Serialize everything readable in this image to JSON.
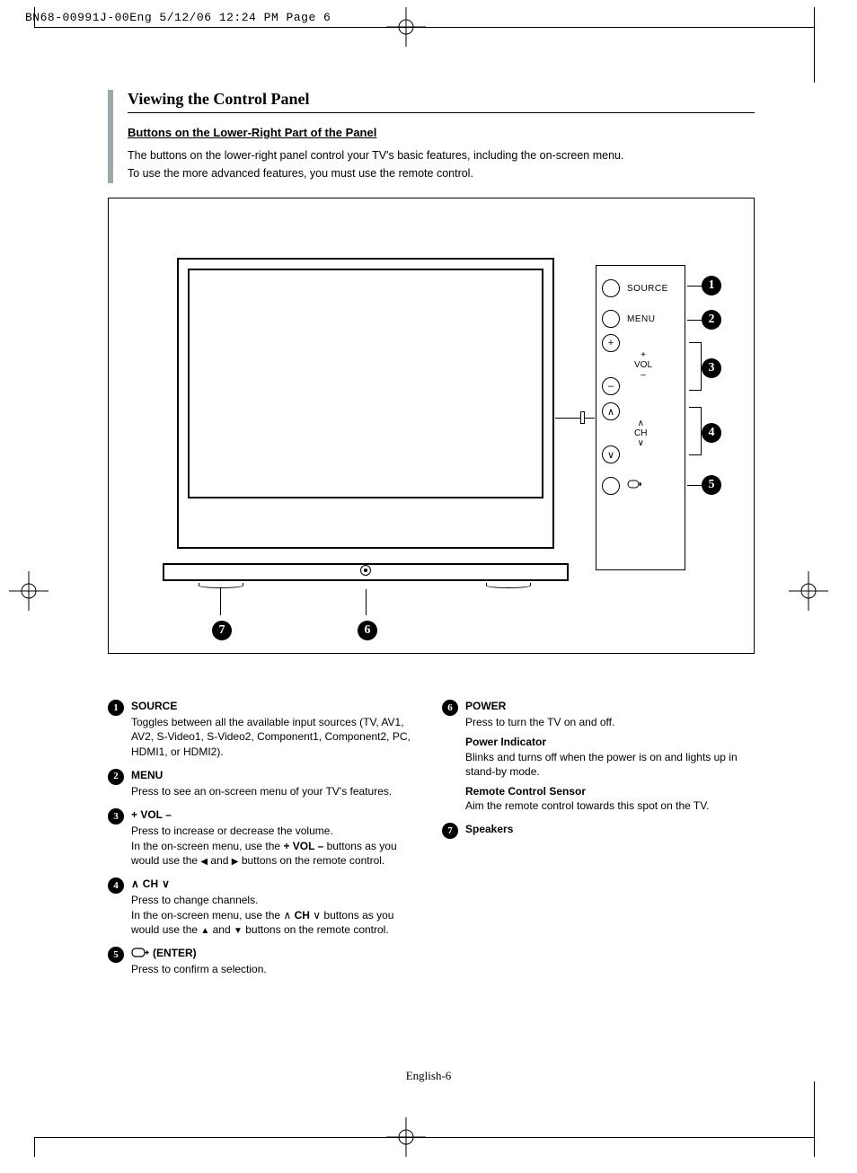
{
  "header": "BN68-00991J-00Eng  5/12/06  12:24 PM  Page 6",
  "title": "Viewing the Control Panel",
  "subtitle": "Buttons on the Lower-Right Part of the Panel",
  "intro1": "The buttons on the lower-right panel control your TV's basic features, including the on-screen menu.",
  "intro2": "To use the more advanced features, you must use the remote control.",
  "panel": {
    "source": "SOURCE",
    "menu": "MENU",
    "vol": "VOL",
    "ch": "CH"
  },
  "callouts": {
    "n1": "1",
    "n2": "2",
    "n3": "3",
    "n4": "4",
    "n5": "5",
    "n6": "6",
    "n7": "7"
  },
  "items": {
    "i1": {
      "title": "SOURCE",
      "body": "Toggles between all the available input sources (TV, AV1, AV2, S-Video1, S-Video2, Component1, Component2, PC, HDMI1, or HDMI2)."
    },
    "i2": {
      "title": "MENU",
      "body": "Press to see an on-screen menu of your TV's features."
    },
    "i3": {
      "title": "+ VOL –",
      "b1": "Press to increase or decrease the volume.",
      "b2a": "In the on-screen menu, use the ",
      "b2b": "+ VOL –",
      "b2c": " buttons as you would use the ",
      "b2d": " and ",
      "b2e": " buttons on the remote control."
    },
    "i4": {
      "titlePre": "CH",
      "b1": "Press to change channels.",
      "b2a": "In the on-screen menu, use the ",
      "b2b": "CH",
      "b2c": " buttons as you would use the ",
      "b2d": " and ",
      "b2e": " buttons on the remote control."
    },
    "i5": {
      "title": "(ENTER)",
      "body": "Press to confirm a selection."
    },
    "i6": {
      "title": "POWER",
      "body": "Press to turn the TV on and off.",
      "sub1t": "Power Indicator",
      "sub1b": "Blinks and turns off when the power is on and lights up in stand-by mode.",
      "sub2t": "Remote Control Sensor",
      "sub2b": "Aim the remote control towards this spot on the TV."
    },
    "i7": {
      "title": "Speakers"
    }
  },
  "footer": "English-6"
}
